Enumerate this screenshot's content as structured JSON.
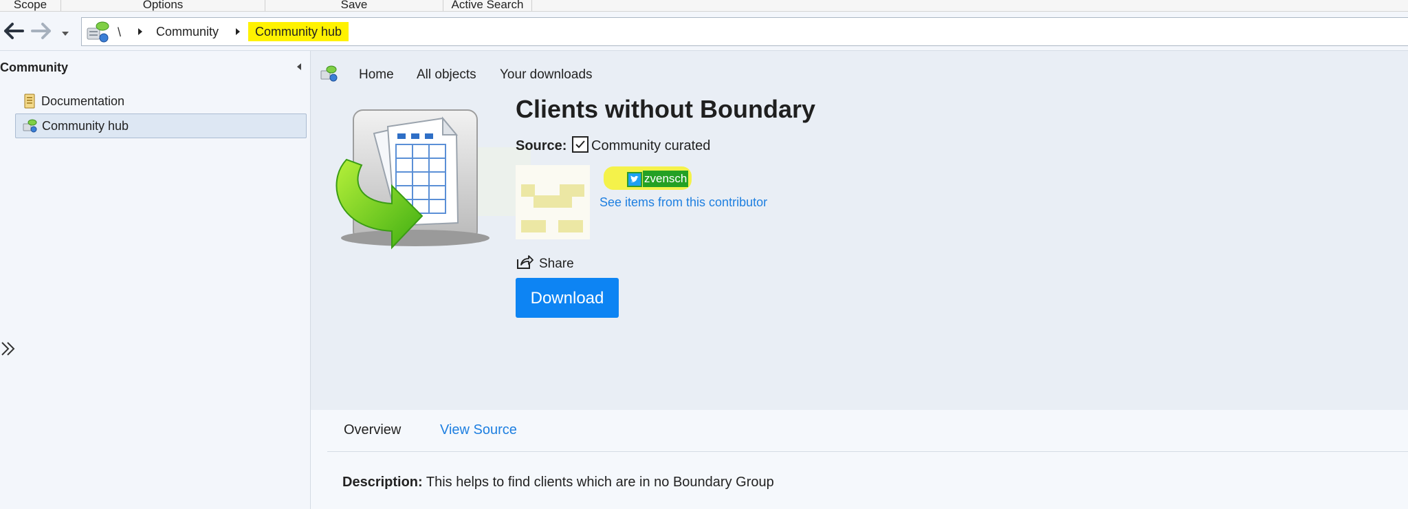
{
  "ribbon": {
    "groups": [
      "Scope",
      "Options",
      "Save",
      "Active Search"
    ]
  },
  "address_bar": {
    "root_separator": "\\",
    "crumbs": [
      "Community",
      "Community hub"
    ]
  },
  "left_pane": {
    "header": "Community",
    "items": [
      {
        "label": "Documentation",
        "icon": "document-icon",
        "selected": false
      },
      {
        "label": "Community hub",
        "icon": "community-hub-icon",
        "selected": true
      }
    ]
  },
  "content": {
    "nav": [
      "Home",
      "All objects",
      "Your downloads"
    ],
    "title": "Clients without Boundary",
    "source_label": "Source:",
    "source_checked": true,
    "source_value": "Community curated",
    "contributor_handle": "zvensch",
    "contributor_link": "See items from this contributor",
    "share_label": "Share",
    "download_label": "Download",
    "tabs": [
      "Overview",
      "View Source"
    ],
    "description_label": "Description:",
    "description": "This helps to find clients which are in no Boundary Group"
  },
  "colors": {
    "accent": "#0d84f3",
    "link": "#1e7fe0",
    "highlight": "#fff200",
    "twitter": "#1da1f2"
  }
}
